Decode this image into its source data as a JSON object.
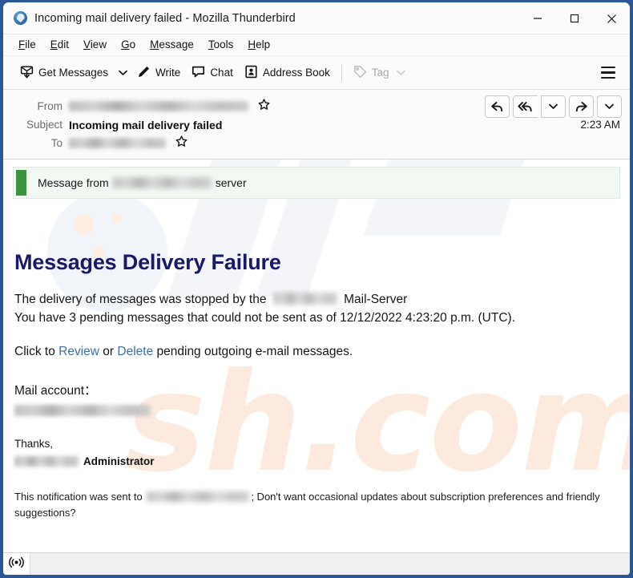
{
  "window": {
    "title": "Incoming mail delivery failed - Mozilla Thunderbird",
    "app_icon": "thunderbird-icon",
    "minimize_label": "Minimize",
    "maximize_label": "Maximize",
    "close_label": "Close",
    "border_color": "#2b5797"
  },
  "menubar": {
    "items": [
      {
        "label": "File",
        "accel": "F"
      },
      {
        "label": "Edit",
        "accel": "E"
      },
      {
        "label": "View",
        "accel": "V"
      },
      {
        "label": "Go",
        "accel": "G"
      },
      {
        "label": "Message",
        "accel": "M"
      },
      {
        "label": "Tools",
        "accel": "T"
      },
      {
        "label": "Help",
        "accel": "H"
      }
    ]
  },
  "toolbar": {
    "get_messages_label": "Get Messages",
    "get_messages_icon": "download-mail-icon",
    "get_messages_dropdown_icon": "chevron-down-icon",
    "write_label": "Write",
    "write_icon": "pencil-icon",
    "chat_label": "Chat",
    "chat_icon": "speech-bubble-icon",
    "address_book_label": "Address Book",
    "address_book_icon": "contact-card-icon",
    "tag_label": "Tag",
    "tag_icon": "tag-icon",
    "tag_dropdown_icon": "chevron-down-icon",
    "tag_disabled": true,
    "app_menu_icon": "hamburger-menu-icon"
  },
  "message_header": {
    "from_label": "From",
    "from_value": "",
    "from_redacted": true,
    "from_star_icon": "star-outline-icon",
    "subject_label": "Subject",
    "subject_value": "Incoming mail delivery failed",
    "to_label": "To",
    "to_value": "",
    "to_redacted": true,
    "to_star_icon": "star-outline-icon",
    "time": "2:23 AM",
    "actions": [
      {
        "name": "reply-button",
        "icon": "reply-arrow-icon"
      },
      {
        "name": "reply-all-button",
        "icon": "reply-all-arrow-icon"
      },
      {
        "name": "reply-all-dropdown",
        "icon": "chevron-down-icon"
      },
      {
        "name": "forward-button",
        "icon": "forward-arrow-icon"
      },
      {
        "name": "more-actions-dropdown",
        "icon": "chevron-down-icon"
      }
    ]
  },
  "banner": {
    "prefix": "Message from",
    "domain_redacted": true,
    "suffix": "server",
    "accent_color": "#3c9442",
    "background_color": "#f2f9f3"
  },
  "mail": {
    "headline": "Messages Delivery Failure",
    "headline_color": "#17196b",
    "para1_before": "The delivery of messages was stopped by the",
    "para1_after": "Mail-Server",
    "para2": "You have 3 pending messages that could not be sent as of 12/12/2022 4:23:20 p.m. (UTC).",
    "pending_count": "3",
    "timestamp": "12/12/2022 4:23:20 p.m. (UTC)",
    "cta_before": "Click to",
    "cta_review": "Review",
    "cta_or": "or",
    "cta_delete": "Delete",
    "cta_after": "pending outgoing e-mail messages.",
    "link_color": "#3b6ea5",
    "mail_account_label": "Mail account：",
    "mail_account_redacted": true,
    "thanks": "Thanks,",
    "signature_domain_redacted": true,
    "signature_role": "Administrator",
    "footnote_before": "This notification was sent to",
    "footnote_after": "; Don't want occasional updates about subscription preferences and friendly suggestions?"
  },
  "watermark": {
    "text": "sh.com",
    "color": "#fdeadf"
  },
  "statusbar": {
    "online_icon": "broadcast-online-icon",
    "status_text": ""
  }
}
